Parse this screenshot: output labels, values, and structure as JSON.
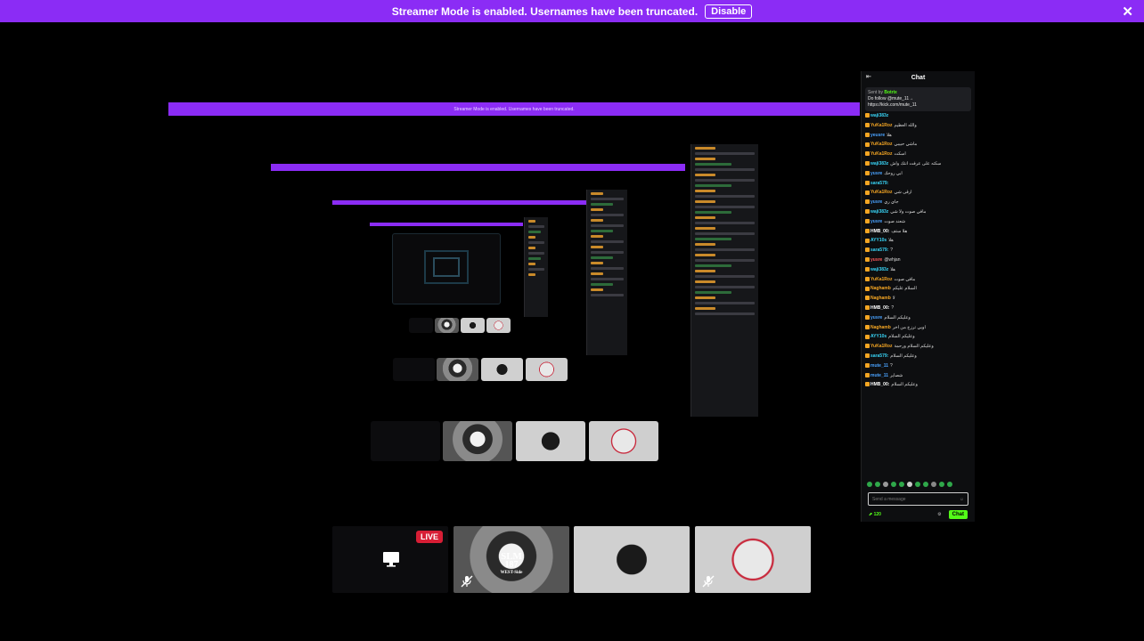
{
  "banner": {
    "message": "Streamer Mode is enabled. Usernames have been truncated.",
    "disable_label": "Disable",
    "close_glyph": "✕"
  },
  "stream": {
    "tiles": [
      {
        "name": "screen-share",
        "badge": "LIVE",
        "icon": "monitor-icon"
      },
      {
        "name": "participant-1",
        "caption_line1": "SLM",
        "caption_line2": "187",
        "caption_line3": "WEST-Side",
        "icon": "mic-muted-icon"
      },
      {
        "name": "participant-2"
      },
      {
        "name": "participant-3",
        "icon": "mic-muted-icon"
      }
    ]
  },
  "chat": {
    "title": "Chat",
    "pinned": {
      "sent_by": "Sent by",
      "brand": "Botrix",
      "text_line1": "Do follow @mute_11→",
      "text_line2": "https://kick.com/mute_11"
    },
    "messages": [
      {
        "user": "waji383z",
        "color": "#38d3f5",
        "text": ""
      },
      {
        "user": "YuKa1Roz",
        "color": "#f5a623",
        "text": "والله العظيم"
      },
      {
        "user": "yeusre",
        "color": "#4aa3ff",
        "text": "هلا"
      },
      {
        "user": "YuKa1Roz",
        "color": "#f5a623",
        "text": "ماشي حبيبي"
      },
      {
        "user": "YuKa1Roz",
        "color": "#f5a623",
        "text": "اسكت"
      },
      {
        "user": "waji383z",
        "color": "#38d3f5",
        "text": "سكته على عرفت انتك واش"
      },
      {
        "user": "yusre",
        "color": "#4aa3ff",
        "text": "ابي روحك"
      },
      {
        "user": "sara579:",
        "color": "#38d3f5",
        "text": ""
      },
      {
        "user": "YuKa1Roz",
        "color": "#f5a623",
        "text": "ارقى شي"
      },
      {
        "user": "yusre",
        "color": "#4aa3ff",
        "text": "جاي ري"
      },
      {
        "user": "waji383z",
        "color": "#38d3f5",
        "text": "مافي صوت ولا شي"
      },
      {
        "user": "yusre",
        "color": "#4aa3ff",
        "text": "شعند صوت"
      },
      {
        "user": "HMB_00:",
        "color": "#ffffff",
        "text": "هلا ستف"
      },
      {
        "user": "AYY10s",
        "color": "#38d3f5",
        "text": "هلا"
      },
      {
        "user": "sara579:",
        "color": "#38d3f5",
        "text": "?"
      },
      {
        "user": "yusre",
        "color": "#ff5a5a",
        "text": "@whjan"
      },
      {
        "user": "waji383z",
        "color": "#38d3f5",
        "text": "هلا"
      },
      {
        "user": "YuKa1Roz",
        "color": "#f5a623",
        "text": "مافي صوت"
      },
      {
        "user": "Naghamb",
        "color": "#f5a623",
        "text": "السلام عليكم"
      },
      {
        "user": "Naghamb",
        "color": "#f5a623",
        "text": "لا"
      },
      {
        "user": "HMB_00:",
        "color": "#ffffff",
        "text": "?"
      },
      {
        "user": "yusre",
        "color": "#4aa3ff",
        "text": "وعليكم السلام"
      },
      {
        "user": "Naghamb",
        "color": "#f5a623",
        "text": "اوبي ترزح من آخر"
      },
      {
        "user": "AYY10s",
        "color": "#38d3f5",
        "text": "وعليكم السلام"
      },
      {
        "user": "YuKa1Roz",
        "color": "#f5a623",
        "text": "وعليكم السلام ورحمة"
      },
      {
        "user": "sara579:",
        "color": "#38d3f5",
        "text": "وعليكم السلام"
      },
      {
        "user": "mute_11",
        "color": "#4aa3ff",
        "text": "?"
      },
      {
        "user": "mute_11",
        "color": "#4aa3ff",
        "text": "شصاير"
      },
      {
        "user": "HMB_00:",
        "color": "#ffffff",
        "text": "وعليكم السلام"
      }
    ],
    "input_placeholder": "Send a message",
    "points": "120",
    "send_label": "Chat"
  },
  "colors": {
    "accent": "#8b2cf5",
    "brand_green": "#53fc18",
    "live_red": "#d71e35"
  }
}
